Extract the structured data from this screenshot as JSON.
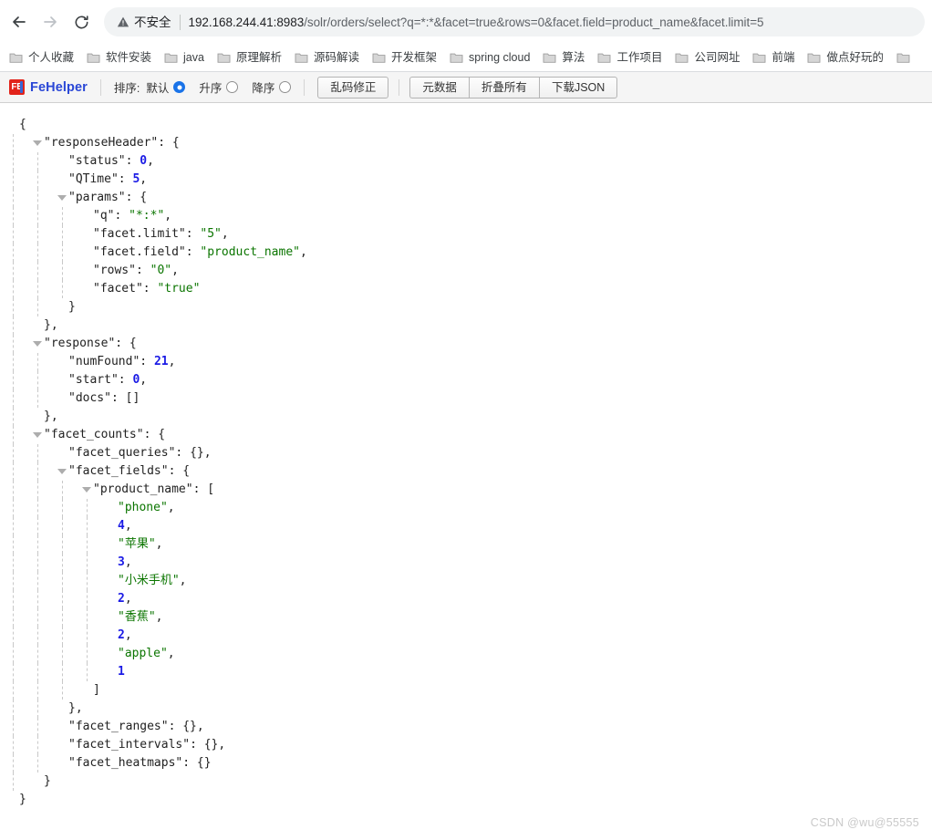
{
  "browser": {
    "back_label": "Back",
    "forward_label": "Forward",
    "reload_label": "Reload",
    "security_label": "不安全",
    "url_host": "192.168.244.41:8983",
    "url_path": "/solr/orders/select?q=*:*&facet=true&rows=0&facet.field=product_name&facet.limit=5",
    "url_full": "192.168.244.41:8983/solr/orders/select?q=*:*&facet=true&rows=0&facet.field=product_name&facet.limit=5"
  },
  "bookmarks": [
    {
      "label": "个人收藏"
    },
    {
      "label": "软件安装"
    },
    {
      "label": "java"
    },
    {
      "label": "原理解析"
    },
    {
      "label": "源码解读"
    },
    {
      "label": "开发框架"
    },
    {
      "label": "spring cloud"
    },
    {
      "label": "算法"
    },
    {
      "label": "工作项目"
    },
    {
      "label": "公司网址"
    },
    {
      "label": "前端"
    },
    {
      "label": "做点好玩的"
    }
  ],
  "fehelper": {
    "brand": "FeHelper",
    "mark": "FE",
    "sort_label": "排序:",
    "sort_options": [
      {
        "label": "默认",
        "selected": true
      },
      {
        "label": "升序",
        "selected": false
      },
      {
        "label": "降序",
        "selected": false
      }
    ],
    "fix_button": "乱码修正",
    "meta_button": "元数据",
    "collapse_button": "折叠所有",
    "download_button": "下载JSON"
  },
  "json_lines": [
    {
      "indent": 0,
      "guides": 0,
      "tri": false,
      "content": "{"
    },
    {
      "indent": 1,
      "guides": 1,
      "tri": true,
      "key": "responseHeader",
      "suffix": ": {"
    },
    {
      "indent": 2,
      "guides": 2,
      "tri": false,
      "key": "status",
      "value": "0",
      "vtype": "n",
      "suffix": ","
    },
    {
      "indent": 2,
      "guides": 2,
      "tri": false,
      "key": "QTime",
      "value": "5",
      "vtype": "n",
      "suffix": ","
    },
    {
      "indent": 2,
      "guides": 2,
      "tri": true,
      "key": "params",
      "suffix": ": {"
    },
    {
      "indent": 3,
      "guides": 3,
      "tri": false,
      "key": "q",
      "value": "\"*:*\"",
      "vtype": "s",
      "suffix": ","
    },
    {
      "indent": 3,
      "guides": 3,
      "tri": false,
      "key": "facet.limit",
      "value": "\"5\"",
      "vtype": "s",
      "suffix": ","
    },
    {
      "indent": 3,
      "guides": 3,
      "tri": false,
      "key": "facet.field",
      "value": "\"product_name\"",
      "vtype": "s",
      "suffix": ","
    },
    {
      "indent": 3,
      "guides": 3,
      "tri": false,
      "key": "rows",
      "value": "\"0\"",
      "vtype": "s",
      "suffix": ","
    },
    {
      "indent": 3,
      "guides": 3,
      "tri": false,
      "key": "facet",
      "value": "\"true\"",
      "vtype": "s",
      "suffix": ""
    },
    {
      "indent": 2,
      "guides": 2,
      "tri": false,
      "content": "}"
    },
    {
      "indent": 1,
      "guides": 1,
      "tri": false,
      "content": "},"
    },
    {
      "indent": 1,
      "guides": 1,
      "tri": true,
      "key": "response",
      "suffix": ": {"
    },
    {
      "indent": 2,
      "guides": 2,
      "tri": false,
      "key": "numFound",
      "value": "21",
      "vtype": "n",
      "suffix": ","
    },
    {
      "indent": 2,
      "guides": 2,
      "tri": false,
      "key": "start",
      "value": "0",
      "vtype": "n",
      "suffix": ","
    },
    {
      "indent": 2,
      "guides": 2,
      "tri": false,
      "key": "docs",
      "value": "[]",
      "vtype": "p",
      "suffix": ""
    },
    {
      "indent": 1,
      "guides": 1,
      "tri": false,
      "content": "},"
    },
    {
      "indent": 1,
      "guides": 1,
      "tri": true,
      "key": "facet_counts",
      "suffix": ": {"
    },
    {
      "indent": 2,
      "guides": 2,
      "tri": false,
      "key": "facet_queries",
      "value": "{}",
      "vtype": "p",
      "suffix": ","
    },
    {
      "indent": 2,
      "guides": 2,
      "tri": true,
      "key": "facet_fields",
      "suffix": ": {"
    },
    {
      "indent": 3,
      "guides": 3,
      "tri": true,
      "key": "product_name",
      "suffix": ": ["
    },
    {
      "indent": 4,
      "guides": 4,
      "tri": false,
      "value": "\"phone\"",
      "vtype": "s",
      "suffix": ","
    },
    {
      "indent": 4,
      "guides": 4,
      "tri": false,
      "value": "4",
      "vtype": "n",
      "suffix": ","
    },
    {
      "indent": 4,
      "guides": 4,
      "tri": false,
      "value": "\"苹果\"",
      "vtype": "s",
      "suffix": ","
    },
    {
      "indent": 4,
      "guides": 4,
      "tri": false,
      "value": "3",
      "vtype": "n",
      "suffix": ","
    },
    {
      "indent": 4,
      "guides": 4,
      "tri": false,
      "value": "\"小米手机\"",
      "vtype": "s",
      "suffix": ","
    },
    {
      "indent": 4,
      "guides": 4,
      "tri": false,
      "value": "2",
      "vtype": "n",
      "suffix": ","
    },
    {
      "indent": 4,
      "guides": 4,
      "tri": false,
      "value": "\"香蕉\"",
      "vtype": "s",
      "suffix": ","
    },
    {
      "indent": 4,
      "guides": 4,
      "tri": false,
      "value": "2",
      "vtype": "n",
      "suffix": ","
    },
    {
      "indent": 4,
      "guides": 4,
      "tri": false,
      "value": "\"apple\"",
      "vtype": "s",
      "suffix": ","
    },
    {
      "indent": 4,
      "guides": 4,
      "tri": false,
      "value": "1",
      "vtype": "n",
      "suffix": ""
    },
    {
      "indent": 3,
      "guides": 3,
      "tri": false,
      "content": "]"
    },
    {
      "indent": 2,
      "guides": 2,
      "tri": false,
      "content": "},"
    },
    {
      "indent": 2,
      "guides": 2,
      "tri": false,
      "key": "facet_ranges",
      "value": "{}",
      "vtype": "p",
      "suffix": ","
    },
    {
      "indent": 2,
      "guides": 2,
      "tri": false,
      "key": "facet_intervals",
      "value": "{}",
      "vtype": "p",
      "suffix": ","
    },
    {
      "indent": 2,
      "guides": 2,
      "tri": false,
      "key": "facet_heatmaps",
      "value": "{}",
      "vtype": "p",
      "suffix": ""
    },
    {
      "indent": 1,
      "guides": 1,
      "tri": false,
      "content": "}"
    },
    {
      "indent": 0,
      "guides": 0,
      "tri": false,
      "content": "}"
    }
  ],
  "watermark": "CSDN @wu@55555",
  "colors": {
    "accent_blue": "#1a73e8",
    "brand_red": "#e2231a",
    "brand_blue": "#2a47d6",
    "json_string": "#0b7500",
    "json_number": "#1a1ae5"
  }
}
